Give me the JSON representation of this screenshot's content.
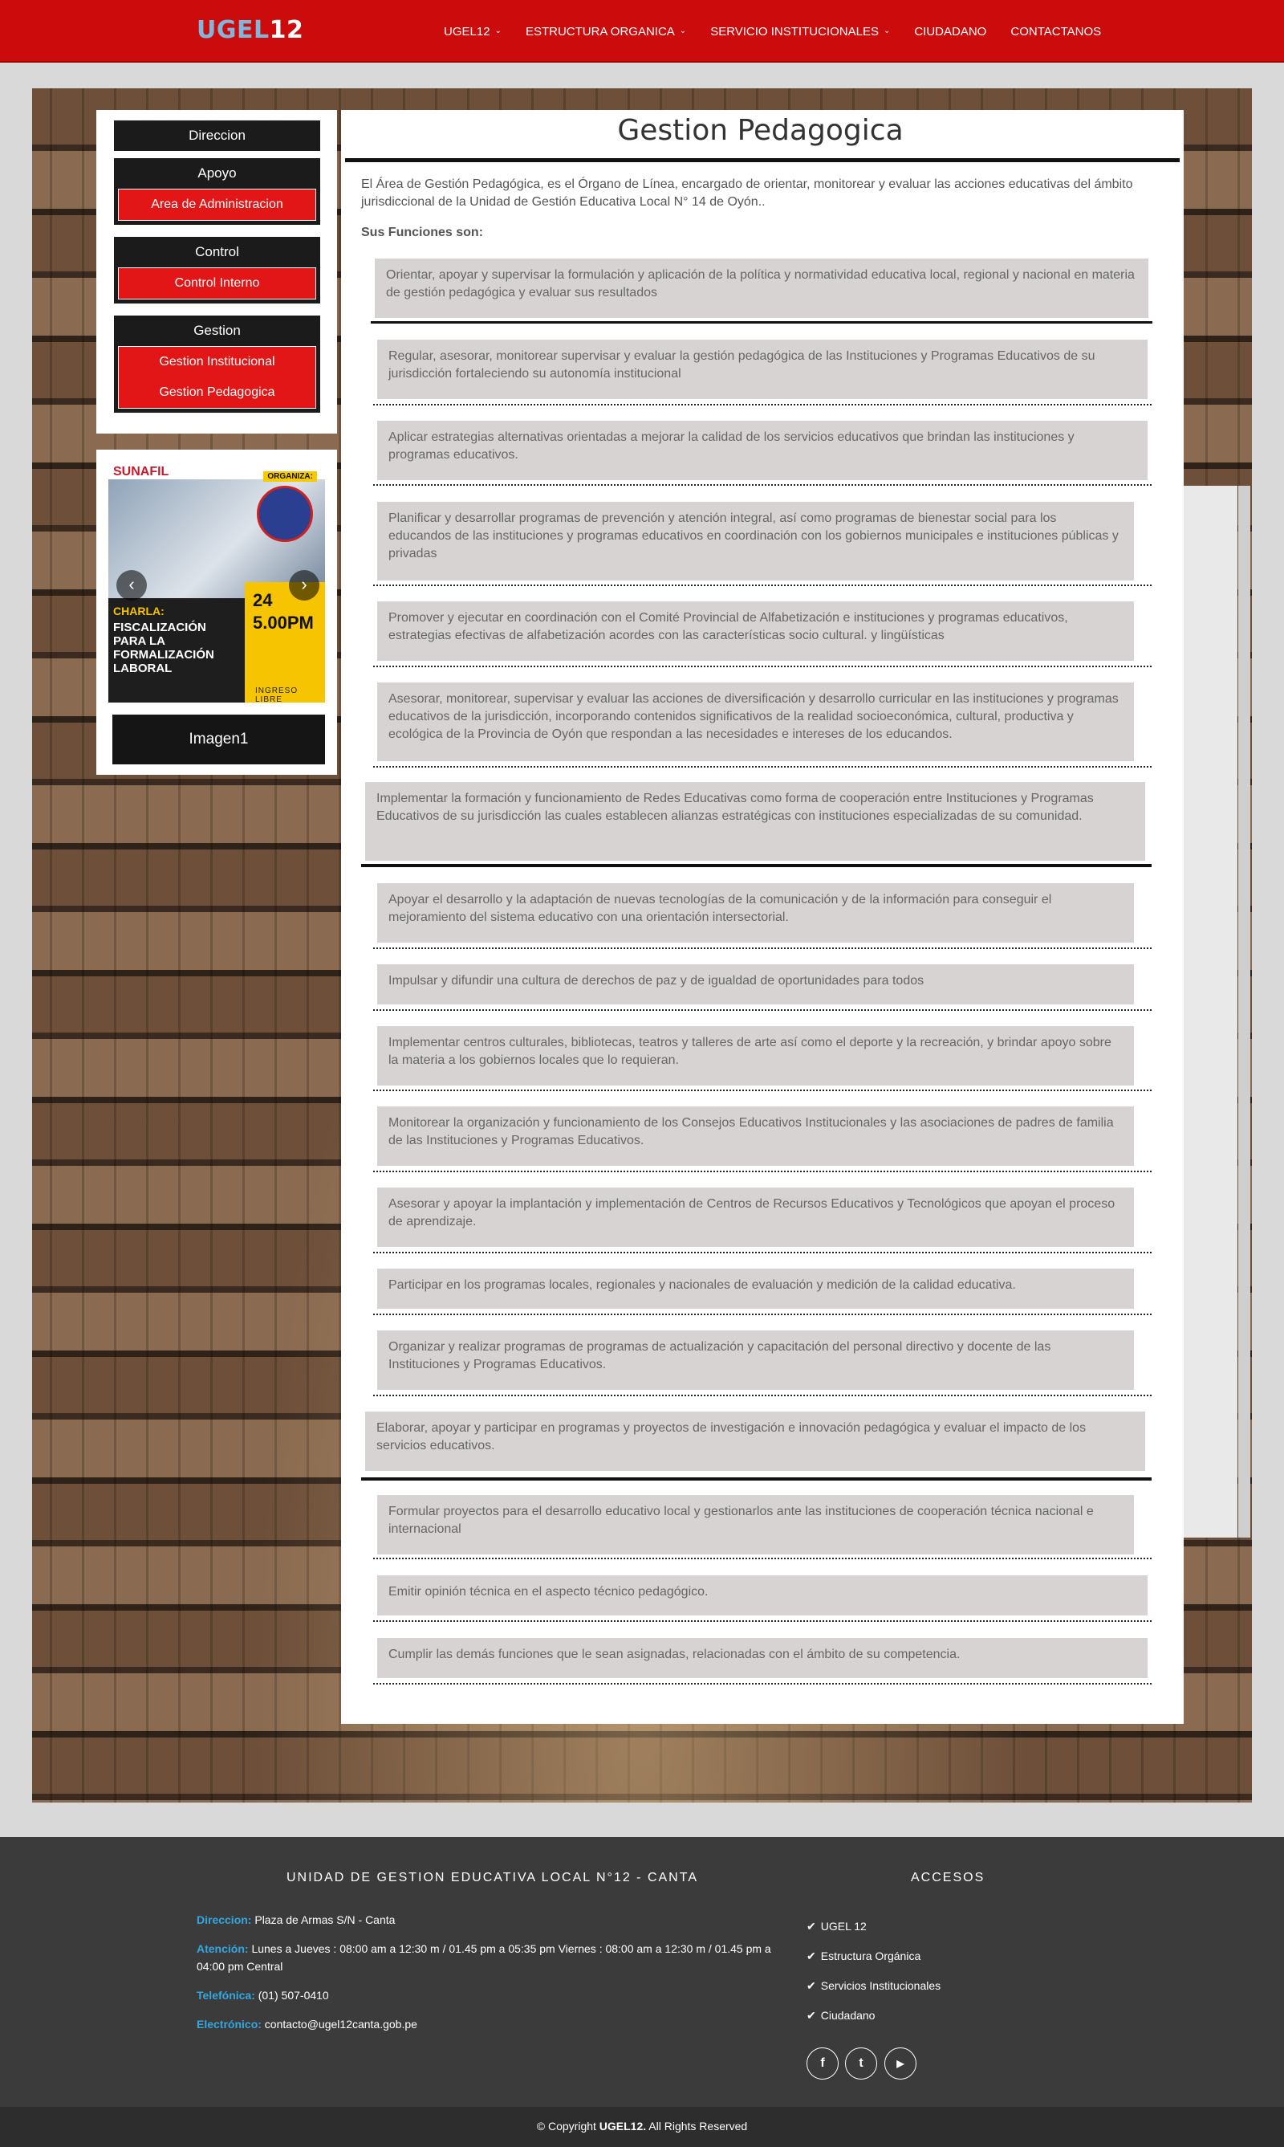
{
  "header": {
    "logo_part1": "UGEL",
    "logo_part2": "12",
    "nav": [
      {
        "label": "UGEL12",
        "has_dropdown": true
      },
      {
        "label": "ESTRUCTURA ORGANICA",
        "has_dropdown": true
      },
      {
        "label": "SERVICIO INSTITUCIONALES",
        "has_dropdown": true
      },
      {
        "label": "CIUDADANO",
        "has_dropdown": false
      },
      {
        "label": "CONTACTANOS",
        "has_dropdown": false
      }
    ],
    "chevron": "⌄"
  },
  "sidebar": {
    "direccion": "Direccion",
    "apoyo": "Apoyo",
    "apoyo_items": [
      "Area de Administracion"
    ],
    "control": "Control",
    "control_items": [
      "Control Interno"
    ],
    "gestion": "Gestion",
    "gestion_items": [
      "Gestion Institucional",
      "Gestion Pedagogica"
    ]
  },
  "carousel": {
    "caption": "Imagen1",
    "prev_symbol": "‹",
    "next_symbol": "›",
    "poster": {
      "brand": "SUNAFIL",
      "org": "ORGANIZA:",
      "charla": "CHARLA:",
      "title": "FISCALIZACIÓN PARA LA FORMALIZACIÓN LABORAL",
      "day": "24",
      "time": "5.00PM",
      "free": "INGRESO LIBRE"
    }
  },
  "main": {
    "title": "Gestion Pedagogica",
    "intro": "El Área de Gestión Pedagógica, es el Órgano de Línea, encargado de orientar, monitorear y evaluar las acciones educativas del ámbito jurisdiccional de la Unidad de Gestión Educativa Local N° 14 de Oyón..",
    "functions_title": "Sus Funciones son:",
    "functions": [
      "Orientar, apoyar y supervisar la formulación y aplicación de la política y normatividad educativa local, regional y nacional en materia de gestión pedagógica y evaluar sus resultados",
      "Regular, asesorar, monitorear supervisar y evaluar la gestión pedagógica de las Instituciones y Programas Educativos de su jurisdicción fortaleciendo su autonomía institucional",
      "Aplicar estrategias alternativas orientadas a mejorar la calidad de los servicios educativos que brindan las instituciones y programas educativos.",
      "Planificar y desarrollar programas de prevención y atención integral, así como programas de bienestar social para los educandos de las instituciones y programas educativos en coordinación con los gobiernos municipales e instituciones públicas y privadas",
      "Promover y ejecutar en coordinación con el Comité Provincial de Alfabetización e instituciones y programas educativos, estrategias efectivas de alfabetización acordes con las características socio cultural. y lingüísticas",
      "Asesorar, monitorear, supervisar y evaluar las acciones de diversificación y desarrollo curricular en las instituciones y programas educativos de la jurisdicción, incorporando contenidos significativos de la realidad socioeconómica, cultural, productiva y ecológica de la Provincia de Oyón que respondan a las necesidades e intereses de los educandos.",
      "Implementar la formación y funcionamiento de Redes Educativas como forma de cooperación entre Instituciones y Programas Educativos de su jurisdicción las cuales establecen alianzas estratégicas con instituciones especializadas de su comunidad.",
      "Apoyar el desarrollo y la adaptación de nuevas tecnologías de la comunicación y de la información para conseguir el mejoramiento del sistema educativo con una orientación intersectorial.",
      "Impulsar y difundir una cultura de derechos de paz y de igualdad de oportunidades para todos",
      "Implementar centros culturales, bibliotecas, teatros y talleres de arte así como el deporte y la recreación, y brindar apoyo sobre la materia a los gobiernos locales que lo requieran.",
      "Monitorear la organización y funcionamiento de los Consejos Educativos Institucionales y las asociaciones de padres de familia de las Instituciones y Programas Educativos.",
      "Asesorar y apoyar la implantación y implementación de Centros de Recursos Educativos y Tecnológicos que apoyan el proceso de aprendizaje.",
      "Participar en los programas locales, regionales y nacionales de evaluación y medición de la calidad educativa.",
      "Organizar y realizar programas de programas de actualización y capacitación del personal directivo y docente de las Instituciones y Programas Educativos.",
      "Elaborar, apoyar y participar en programas y proyectos de investigación e innovación pedagógica y evaluar el impacto de los servicios educativos.",
      "Formular proyectos para el desarrollo educativo local y gestionarlos ante las instituciones de cooperación técnica nacional e internacional",
      "Emitir opinión técnica en el aspecto técnico pedagógico.",
      "Cumplir las demás funciones que le sean asignadas, relacionadas con el ámbito de su competencia."
    ]
  },
  "footer": {
    "title": "UNIDAD DE GESTION EDUCATIVA LOCAL N°12 - CANTA",
    "address_label": "Direccion:",
    "address": "Plaza de Armas S/N - Canta",
    "hours_label": "Atención:",
    "hours": "Lunes a Jueves : 08:00 am a 12:30 m / 01.45 pm a 05:35 pm Viernes : 08:00 am a 12:30 m / 01.45 pm a 04:00 pm Central",
    "phone_label": "Telefónica:",
    "phone": "(01) 507-0410",
    "email_label": "Electrónico:",
    "email": "contacto@ugel12canta.gob.pe",
    "accesos_title": "ACCESOS",
    "check": "✔",
    "accesos": [
      "UGEL 12",
      "Estructura Orgánica",
      "Servicios Institucionales",
      "Ciudadano"
    ],
    "social": [
      {
        "icon": "facebook-icon",
        "glyph": "f"
      },
      {
        "icon": "twitter-icon",
        "glyph": "t"
      },
      {
        "icon": "youtube-icon",
        "glyph": "▶"
      }
    ],
    "copyright_prefix": "© Copyright",
    "copyright_brand": "UGEL12.",
    "copyright_suffix": "All Rights Reserved"
  }
}
